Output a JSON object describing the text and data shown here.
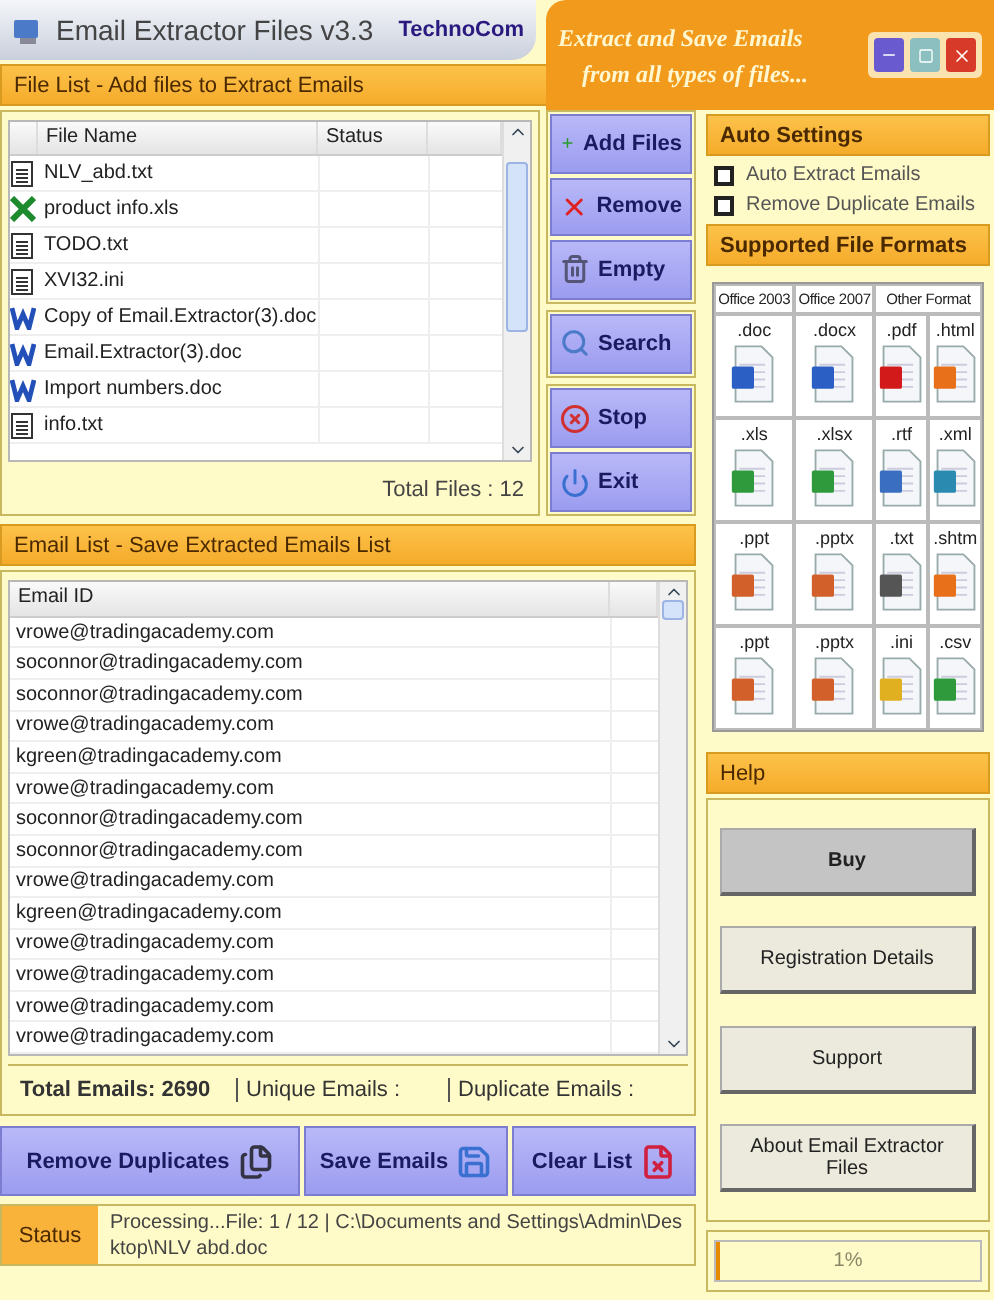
{
  "window": {
    "title": "Email Extractor Files v3.3",
    "brand": "TechnoCom",
    "tagline": [
      "Extract and Save Emails",
      "from all types of files..."
    ]
  },
  "file_list": {
    "title": "File List - Add files to Extract Emails",
    "columns": [
      "File Name",
      "Status"
    ],
    "rows": [
      {
        "name": "NLV_abd.txt",
        "kind": "text"
      },
      {
        "name": "product info.xls",
        "kind": "sheet"
      },
      {
        "name": "TODO.txt",
        "kind": "text"
      },
      {
        "name": "XVI32.ini",
        "kind": "text"
      },
      {
        "name": "Copy of Email.Extractor(3).doc",
        "kind": "doc"
      },
      {
        "name": "Email.Extractor(3).doc",
        "kind": "doc"
      },
      {
        "name": "Import numbers.doc",
        "kind": "doc"
      },
      {
        "name": "info.txt",
        "kind": "text"
      }
    ],
    "total": "Total Files : 12"
  },
  "file_actions": [
    {
      "label": "Add Files",
      "kind": "add"
    },
    {
      "label": "Remove",
      "kind": "remove"
    },
    {
      "label": "Empty",
      "kind": "empty"
    },
    {
      "label": "Search",
      "kind": "search"
    },
    {
      "label": "Stop",
      "kind": "stop"
    },
    {
      "label": "Exit",
      "kind": "exit"
    }
  ],
  "email_list": {
    "title": "Email List - Save Extracted Emails List",
    "column": "Email ID",
    "rows": [
      "vrowe@tradingacademy.com",
      "soconnor@tradingacademy.com",
      "soconnor@tradingacademy.com",
      "vrowe@tradingacademy.com",
      "kgreen@tradingacademy.com",
      "vrowe@tradingacademy.com",
      "soconnor@tradingacademy.com",
      "soconnor@tradingacademy.com",
      "vrowe@tradingacademy.com",
      "kgreen@tradingacademy.com",
      "vrowe@tradingacademy.com",
      "vrowe@tradingacademy.com",
      "vrowe@tradingacademy.com",
      "vrowe@tradingacademy.com"
    ],
    "totals": [
      "Total Emails: 2690",
      "Unique Emails :",
      "Duplicate Emails :"
    ]
  },
  "email_actions": [
    {
      "label": "Remove Duplicates",
      "kind": "dedupe"
    },
    {
      "label": "Save Emails",
      "kind": "save"
    },
    {
      "label": "Clear List",
      "kind": "clear"
    }
  ],
  "auto_settings": {
    "title": "Auto Settings",
    "options": [
      {
        "label": "Auto Extract Emails",
        "checked": false
      },
      {
        "label": "Remove Duplicate Emails",
        "checked": false
      }
    ]
  },
  "formats": {
    "title": "Supported File Formats",
    "groups": [
      {
        "label": "Office 2003",
        "wide": false
      },
      {
        "label": "Office 2007",
        "wide": false
      },
      {
        "label": "Other Format",
        "wide": true
      }
    ],
    "rows": [
      [
        {
          "ext": ".doc",
          "kind": "word"
        },
        {
          "ext": ".docx",
          "kind": "word"
        },
        {
          "ext": ".pdf",
          "kind": "pdf"
        },
        {
          "ext": ".html",
          "kind": "web"
        }
      ],
      [
        {
          "ext": ".xls",
          "kind": "excel"
        },
        {
          "ext": ".xlsx",
          "kind": "excel"
        },
        {
          "ext": ".rtf",
          "kind": "rtf"
        },
        {
          "ext": ".xml",
          "kind": "xml"
        }
      ],
      [
        {
          "ext": ".ppt",
          "kind": "ppt"
        },
        {
          "ext": ".pptx",
          "kind": "ppt"
        },
        {
          "ext": ".txt",
          "kind": "text"
        },
        {
          "ext": ".shtm",
          "kind": "web"
        }
      ],
      [
        {
          "ext": ".ppt",
          "kind": "ppt"
        },
        {
          "ext": ".pptx",
          "kind": "ppt"
        },
        {
          "ext": ".ini",
          "kind": "ini"
        },
        {
          "ext": ".csv",
          "kind": "excel"
        }
      ]
    ]
  },
  "help": {
    "title": "Help",
    "buttons": [
      {
        "label": "Buy",
        "selected": true
      },
      {
        "label": "Registration Details",
        "selected": false
      },
      {
        "label": "Support",
        "selected": false
      },
      {
        "label": "About Email Extractor Files",
        "selected": false
      }
    ]
  },
  "status": {
    "label": "Status",
    "message": "Processing...File: 1 / 12 | C:\\Documents and Settings\\Admin\\Desktop\\NLV abd.doc",
    "level": 0.01,
    "reading": "1%"
  }
}
